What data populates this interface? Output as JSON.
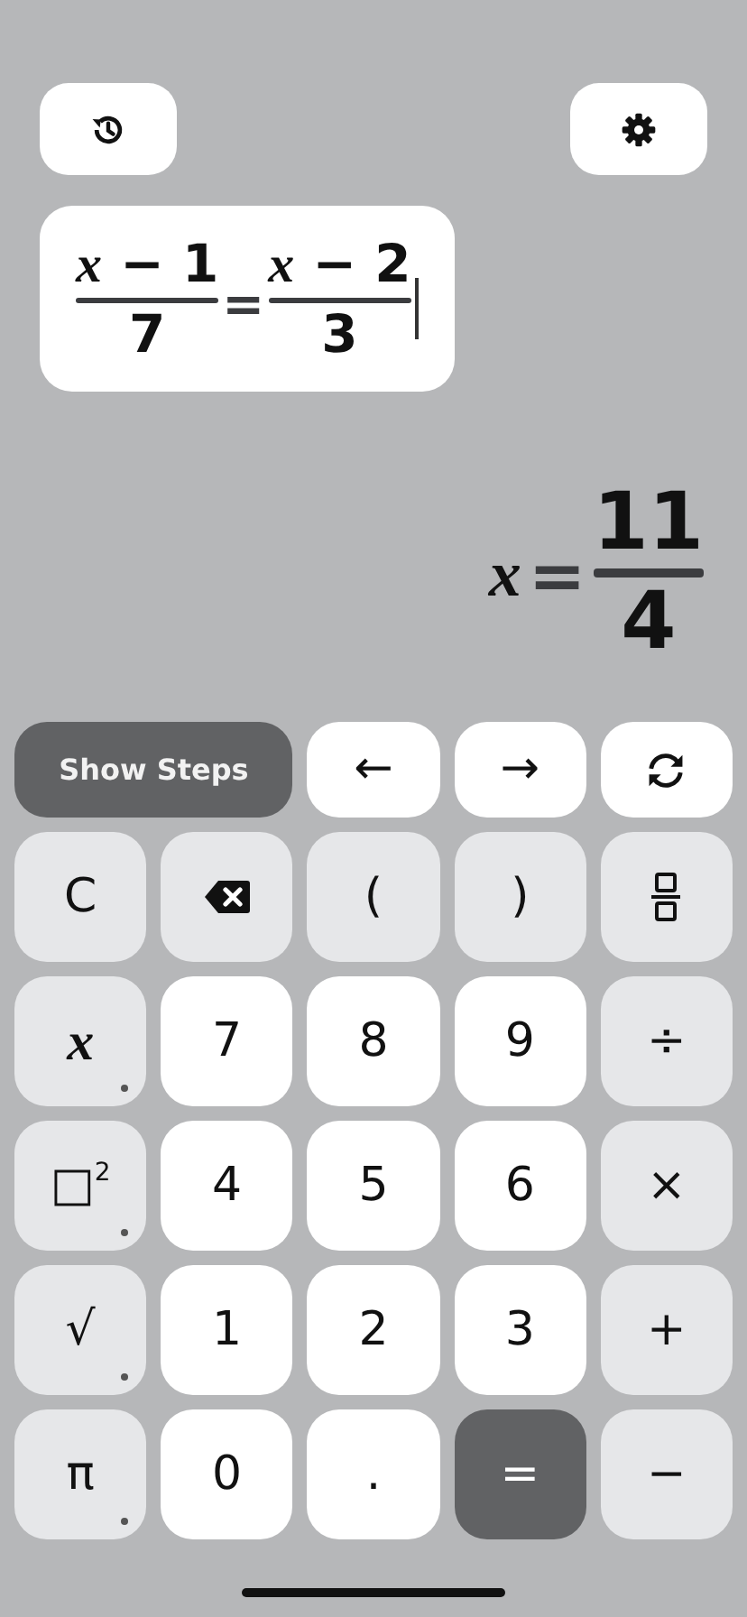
{
  "top_buttons": [
    {
      "kind": "history"
    },
    {
      "kind": "settings"
    }
  ],
  "input": {
    "lhs": {
      "numerator": "*x* − 1",
      "denominator": "7"
    },
    "relation": "=",
    "rhs": {
      "numerator": "*x* − 2",
      "denominator": "3"
    },
    "cursor": true
  },
  "result": {
    "variable": "x",
    "relation": "=",
    "numerator": "11",
    "denominator": "4"
  },
  "toolbar": [
    {
      "kind": "show_steps",
      "label": "Show Steps"
    },
    {
      "kind": "arrow",
      "label": "←"
    },
    {
      "kind": "arrow",
      "label": "→"
    },
    {
      "kind": "refresh"
    }
  ],
  "keys": [
    {
      "kind": "operator",
      "label": "C",
      "has_more": false
    },
    {
      "kind": "backspace",
      "has_more": false
    },
    {
      "kind": "operator",
      "label": "(",
      "has_more": false
    },
    {
      "kind": "operator",
      "label": ")",
      "has_more": false
    },
    {
      "kind": "fraction",
      "has_more": false
    },
    {
      "kind": "variable",
      "label": "x",
      "has_more": true
    },
    {
      "kind": "digit",
      "label": "7",
      "has_more": false
    },
    {
      "kind": "digit",
      "label": "8",
      "has_more": false
    },
    {
      "kind": "digit",
      "label": "9",
      "has_more": false
    },
    {
      "kind": "operator",
      "label": "÷",
      "has_more": false
    },
    {
      "kind": "operator",
      "label": "□$^{2}$",
      "has_more": true
    },
    {
      "kind": "digit",
      "label": "4",
      "has_more": false
    },
    {
      "kind": "digit",
      "label": "5",
      "has_more": false
    },
    {
      "kind": "digit",
      "label": "6",
      "has_more": false
    },
    {
      "kind": "operator",
      "label": "×",
      "has_more": false
    },
    {
      "kind": "operator",
      "label": "√",
      "has_more": true
    },
    {
      "kind": "digit",
      "label": "1",
      "has_more": false
    },
    {
      "kind": "digit",
      "label": "2",
      "has_more": false
    },
    {
      "kind": "digit",
      "label": "3",
      "has_more": false
    },
    {
      "kind": "operator",
      "label": "+",
      "has_more": false
    },
    {
      "kind": "operator",
      "label": "π",
      "has_more": true
    },
    {
      "kind": "digit",
      "label": "0",
      "has_more": false
    },
    {
      "kind": "digit",
      "label": ".",
      "has_more": false
    },
    {
      "kind": "equals",
      "label": "=",
      "has_more": false
    },
    {
      "kind": "operator",
      "label": "−",
      "has_more": false
    }
  ]
}
